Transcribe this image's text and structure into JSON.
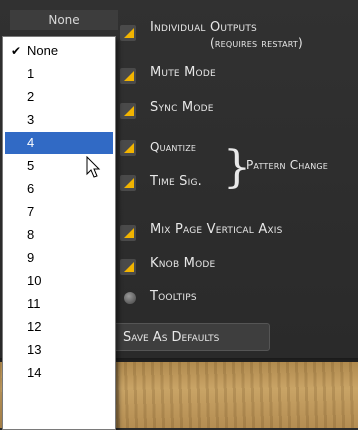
{
  "dropdown": {
    "selected": "None",
    "options": [
      "None",
      "1",
      "2",
      "3",
      "4",
      "5",
      "6",
      "7",
      "8",
      "9",
      "10",
      "11",
      "12",
      "13",
      "14"
    ],
    "highlighted": "4"
  },
  "options": {
    "individual_outputs": "Individual Outputs",
    "requires_restart": "(requires restart)",
    "mute_mode": "Mute Mode",
    "sync_mode": "Sync Mode",
    "quantize": "Quantize",
    "time_sig": "Time Sig.",
    "pattern_change": "Pattern Change",
    "mix_page_axis": "Mix Page Vertical Axis",
    "knob_mode": "Knob Mode",
    "tooltips": "Tooltips"
  },
  "buttons": {
    "save_defaults": "Save As Defaults"
  },
  "colors": {
    "accent": "#f2b400",
    "highlight": "#316ac5"
  }
}
